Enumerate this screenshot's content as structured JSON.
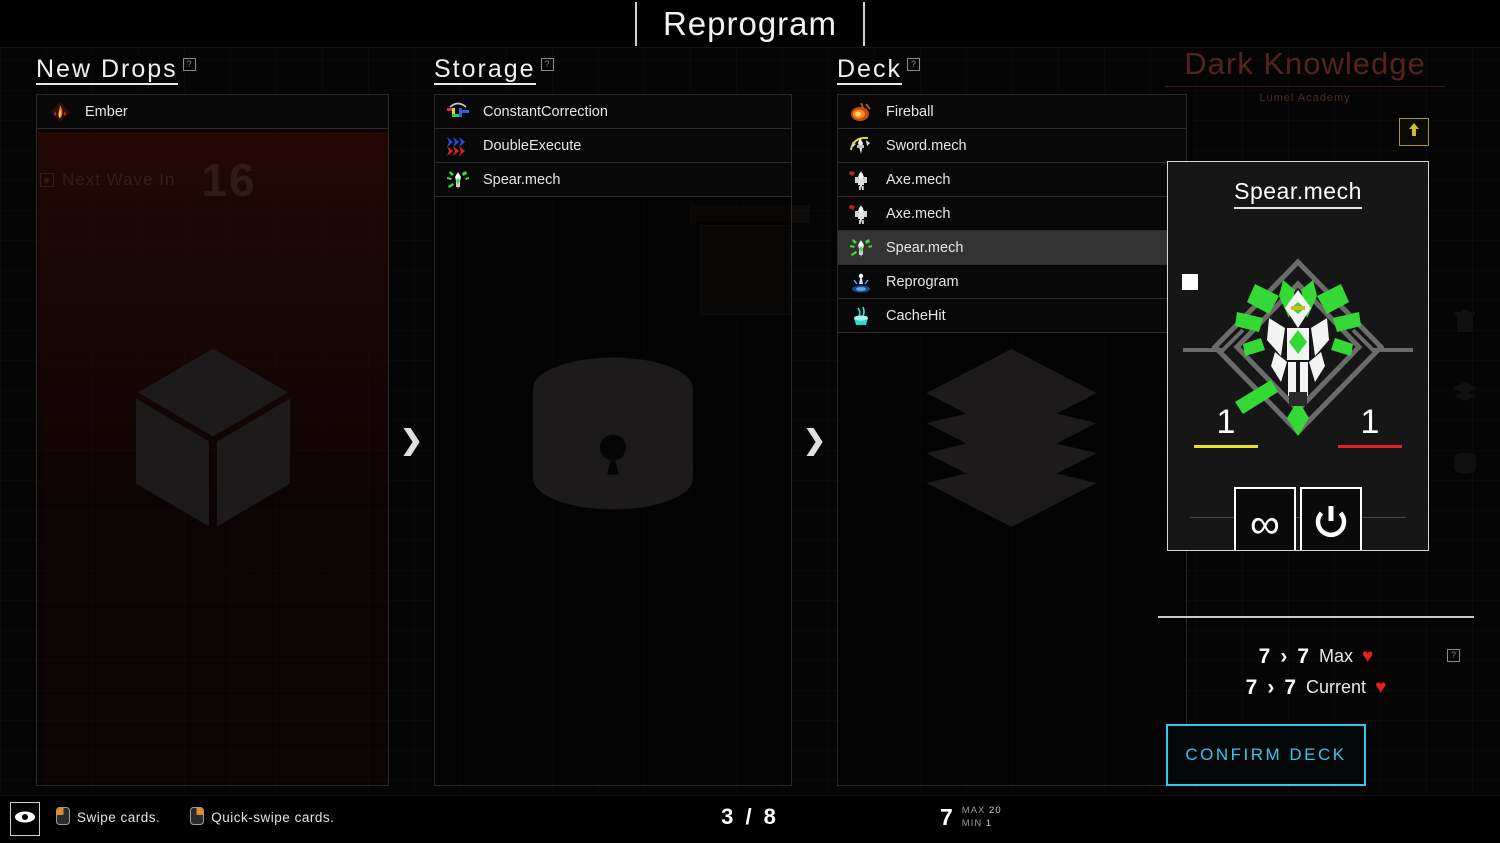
{
  "header": {
    "title": "Reprogram"
  },
  "background": {
    "wave_label": "Next Wave In",
    "wave_value": "16",
    "dark_knowledge_title": "Dark Knowledge",
    "dark_knowledge_sub": "Lumel Academy"
  },
  "columns": {
    "new_drops": {
      "title": "New Drops",
      "help": "?",
      "watermark": "package-box-icon",
      "items": [
        {
          "name": "Ember",
          "icon": "ember-flame-icon"
        }
      ]
    },
    "storage": {
      "title": "Storage",
      "help": "?",
      "watermark": "locked-database-icon",
      "items": [
        {
          "name": "ConstantCorrection",
          "icon": "constant-correction-icon"
        },
        {
          "name": "DoubleExecute",
          "icon": "double-execute-icon"
        },
        {
          "name": "Spear.mech",
          "icon": "spear-mech-icon"
        }
      ]
    },
    "deck": {
      "title": "Deck",
      "help": "?",
      "watermark": "card-layers-icon",
      "items": [
        {
          "name": "Fireball",
          "icon": "fireball-icon",
          "selected": false
        },
        {
          "name": "Sword.mech",
          "icon": "sword-mech-icon",
          "selected": false
        },
        {
          "name": "Axe.mech",
          "icon": "axe-mech-icon",
          "selected": false
        },
        {
          "name": "Axe.mech",
          "icon": "axe-mech-icon",
          "selected": false
        },
        {
          "name": "Spear.mech",
          "icon": "spear-mech-icon",
          "selected": true
        },
        {
          "name": "Reprogram",
          "icon": "reprogram-icon",
          "selected": false
        },
        {
          "name": "CacheHit",
          "icon": "cache-hit-icon",
          "selected": false
        }
      ]
    }
  },
  "separators": {
    "chevron": "❯"
  },
  "detail": {
    "upgrade_badge_icon": "upgrade-arrow-icon",
    "card": {
      "name": "Spear.mech",
      "attack": "1",
      "health": "1",
      "attack_bar_color": "#e2e228",
      "health_bar_color": "#e02020",
      "actions": [
        {
          "icon": "infinity-icon",
          "glyph": "∞"
        },
        {
          "icon": "power-icon",
          "glyph": "power"
        }
      ]
    },
    "health_stats": {
      "help": "?",
      "rows": [
        {
          "from": "7",
          "arrow": "›",
          "to": "7",
          "label": "Max",
          "heart": "♥"
        },
        {
          "from": "7",
          "arrow": "›",
          "to": "7",
          "label": "Current",
          "heart": "♥"
        }
      ]
    },
    "confirm_button": "CONFIRM DECK"
  },
  "bottom_bar": {
    "eye_icon": "eye-icon",
    "hints": [
      {
        "icon": "mouse-left-click-icon",
        "text": "Swipe cards."
      },
      {
        "icon": "mouse-right-click-icon",
        "text": "Quick-swipe cards."
      }
    ],
    "storage_count": "3 / 8",
    "deck_count": "7",
    "deck_max_label": "MAX",
    "deck_max_value": "20",
    "deck_min_label": "MIN",
    "deck_min_value": "1"
  },
  "colors": {
    "accent_cyan": "#35c8ef",
    "heart_red": "#e81f1f",
    "upgrade_yellow": "#a39a22"
  }
}
